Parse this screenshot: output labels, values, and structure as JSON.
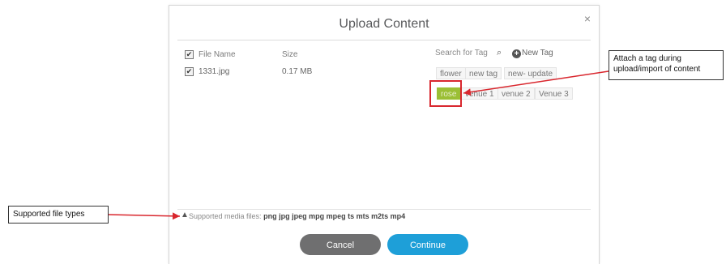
{
  "dialog": {
    "title": "Upload Content",
    "close_glyph": "×"
  },
  "table": {
    "col_file_name": "File Name",
    "col_size": "Size",
    "rows": [
      {
        "file_name": "1331.jpg",
        "size": "0.17 MB",
        "checked": true
      }
    ]
  },
  "tags": {
    "search_placeholder": "Search for Tag",
    "new_tag_label": "New Tag",
    "items": [
      "flower",
      "new tag",
      "new- update",
      "rose",
      "venue 1",
      "venue 2",
      "Venue 3"
    ],
    "selected": "rose"
  },
  "footer": {
    "supported_label": "Supported media files:",
    "supported_types": "png jpg jpeg mpg mpeg ts mts m2ts mp4",
    "cancel_label": "Cancel",
    "continue_label": "Continue"
  },
  "annotations": {
    "tag_callout": "Attach a tag during upload/import of content",
    "filetypes_callout": "Supported file types"
  },
  "colors": {
    "continue": "#1e9fd8",
    "cancel": "#6f6f70",
    "selected_tag": "#9bbf35",
    "highlight": "#d9272e"
  }
}
